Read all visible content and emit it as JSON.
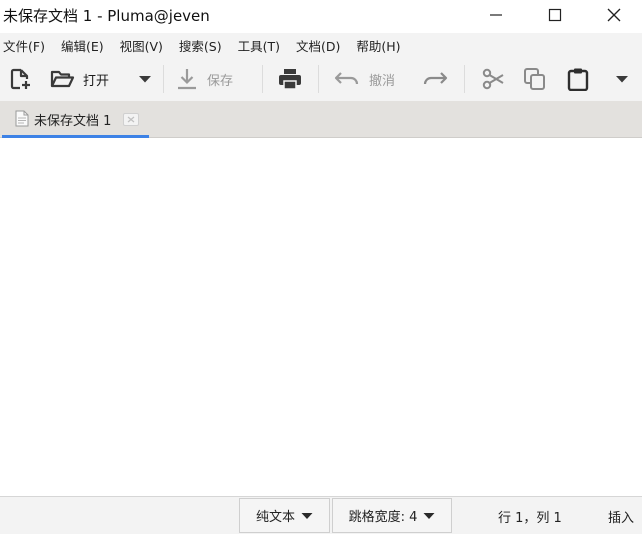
{
  "window": {
    "title": "未保存文档 1 - Pluma@jeven"
  },
  "menu": {
    "items": [
      {
        "label": "文件(F)"
      },
      {
        "label": "编辑(E)"
      },
      {
        "label": "视图(V)"
      },
      {
        "label": "搜索(S)"
      },
      {
        "label": "工具(T)"
      },
      {
        "label": "文档(D)"
      },
      {
        "label": "帮助(H)"
      }
    ]
  },
  "toolbar": {
    "open_label": "打开",
    "save_label": "保存",
    "undo_label": "撤消",
    "icons": [
      "new-document-icon",
      "open-folder-icon",
      "chevron-down-icon",
      "save-download-icon",
      "print-icon",
      "undo-icon",
      "redo-icon",
      "cut-icon",
      "copy-icon",
      "paste-icon",
      "overflow-chevron-icon"
    ]
  },
  "tabs": [
    {
      "label": "未保存文档 1",
      "active": true
    }
  ],
  "statusbar": {
    "language": "纯文本",
    "tab_width": "跳格宽度: 4",
    "position": "行 1，列 1",
    "mode": "插入"
  },
  "colors": {
    "accent": "#3d82e6",
    "toolbar_bg": "#f3f3f3",
    "tabstrip_bg": "#e3e1de",
    "icon": "#3a3a3a",
    "icon_disabled": "#9a9a9a"
  }
}
